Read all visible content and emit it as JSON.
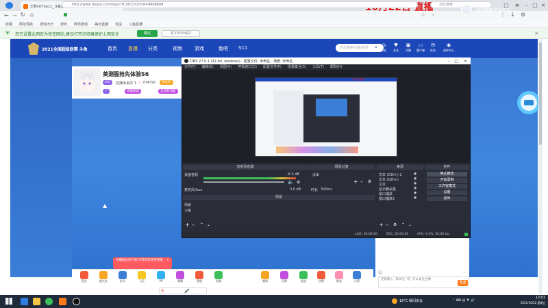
{
  "browser": {
    "tab_title": "王醉sO75e11_斗鱼直播 - 斗鱼直播",
    "watermark_number": "1121567221384",
    "date_overlay": "10月22日 直播",
    "url": "http://www.douyu.com/topic/YC/VCQ7Z?rid=4666609",
    "search_placeholder": "点此搜索",
    "bookmarks": [
      "收藏",
      "网址导航",
      "游戏大厅",
      "游戏",
      "网页游戏",
      "美女直播",
      "淘宝",
      "斗鱼直播"
    ],
    "notice_text": "您已设置此网页为信任网站,建议打开浏览器保护上网安全",
    "notice_ok": "确定",
    "notice_no": "暂不开启保护"
  },
  "site": {
    "logo_text": "2021全国超级联赛 斗鱼",
    "nav": [
      "首页",
      "直播",
      "分类",
      "视频",
      "游戏",
      "鱼吧",
      "S11"
    ],
    "search_placeholder": "点击搜索主播/房间",
    "header_icons": [
      {
        "icon": "history-icon",
        "label": "历史"
      },
      {
        "icon": "follow-icon",
        "label": "关注"
      },
      {
        "icon": "broadcast-icon",
        "label": "开播"
      },
      {
        "icon": "client-icon",
        "label": "客户端"
      },
      {
        "icon": "task-icon",
        "label": "任务"
      },
      {
        "icon": "center-icon",
        "label": "创作中心"
      }
    ],
    "user_name": "浪迹巅峰/不破不立"
  },
  "stream": {
    "room_title": "美测服抢先体验S6",
    "level": "LV2",
    "nickname": "初播未来的飞",
    "hot": "704798",
    "tags": [
      "风云的",
      "英雄联盟",
      "互动新功能"
    ]
  },
  "obs": {
    "title": "OBS 27.0.1 (32-bit, windows) - 配置文件: 未命名 - 场景: 未命名",
    "menu": [
      "文件(F)",
      "编辑(E)",
      "视图(V)",
      "停靠窗口(D)",
      "配置文件(P)",
      "场景集合(S)",
      "工具(T)",
      "帮助(H)"
    ],
    "preview_label": "斗鱼直播间",
    "mixer_title": "音频混音器",
    "mixer_rows": [
      {
        "label": "桌面音频",
        "value": "-6.5 dB"
      },
      {
        "label": "麦克风/Aux",
        "value": "0.0 dB"
      }
    ],
    "transition_title": "场景过渡",
    "transition_type": "淡出",
    "transition_duration_label": "时长",
    "transition_duration": "300ms",
    "scenes_title": "场景",
    "scenes": [
      "场景",
      "斗鱼"
    ],
    "sources_title": "来源",
    "sources": [
      "文本 (GDI+) 2",
      "文本 (GDI+)",
      "文本",
      "显示器采集",
      "窗口捕获",
      "窗口捕获2"
    ],
    "controls_title": "控件",
    "controls": [
      "停止推流",
      "开始录制",
      "工作室模式",
      "设置",
      "退出"
    ],
    "status": {
      "live": "LIVE: 00:00:00",
      "rec": "REC: 00:00:00",
      "cpu": "CPU: 0.4%, 30.00 fps"
    }
  },
  "chat": {
    "tip": "主播送出的礼物,可获得双倍亲密度",
    "input_placeholder": "还能输入 \"来关注\" 吧, 可以关注主播",
    "send": "发送",
    "gifts": [
      "鱼丸",
      "超大丸",
      "办卡",
      "飞天",
      "PK",
      "弹幕",
      "鱼翅",
      "礼物",
      "福袋",
      "天降",
      "加油",
      "点赞",
      "鲜花",
      "火箭"
    ]
  },
  "taskbar": {
    "weather": "18°C 晴间多云",
    "time": "12:01",
    "date": "2021/10/22 星期五"
  },
  "colors": {
    "site_blue": "#1c47b8",
    "date_red": "#e0191c",
    "notice_green": "#27a74a",
    "obs_dark": "#2b2e38",
    "gift_tip": "#ff5a5f"
  }
}
